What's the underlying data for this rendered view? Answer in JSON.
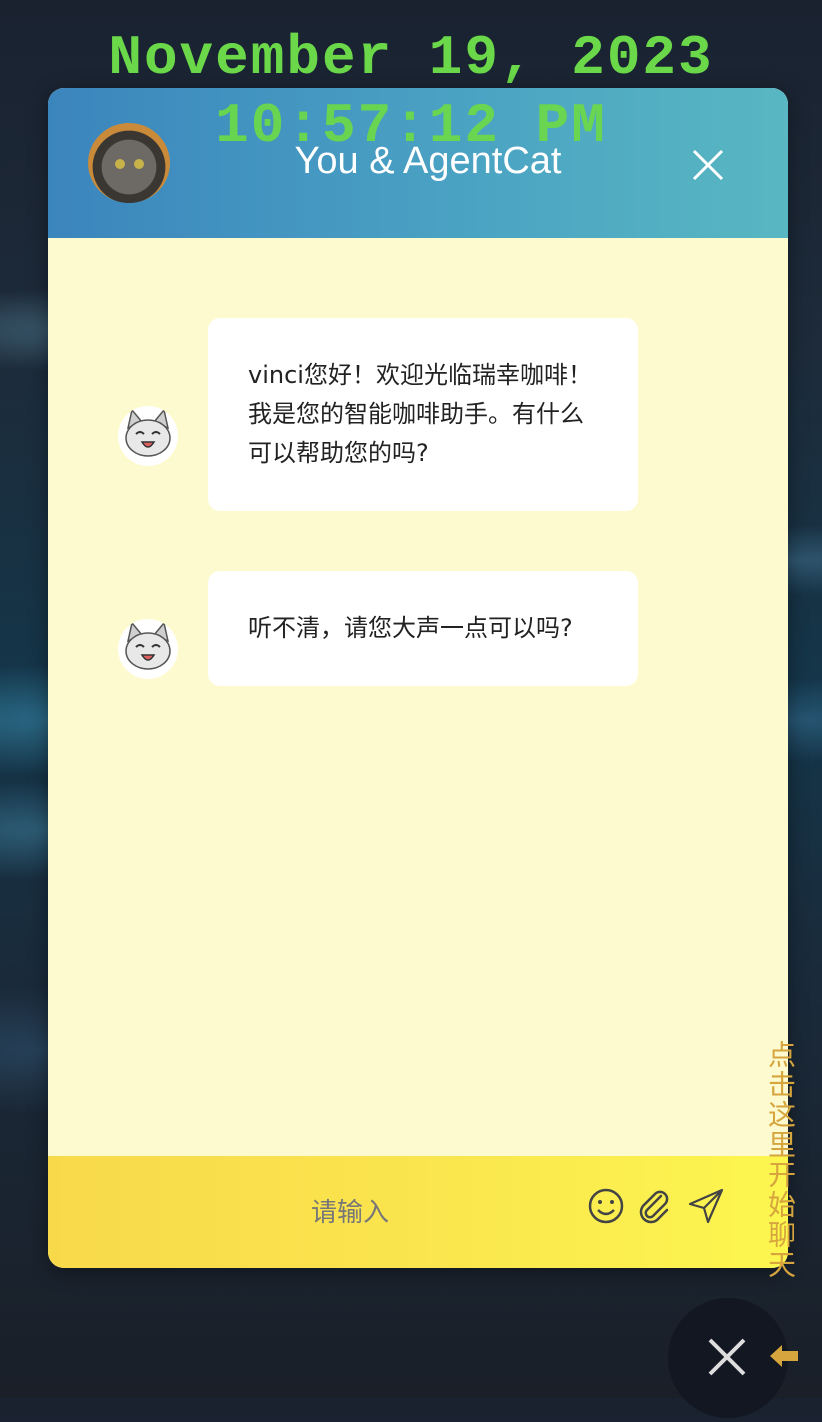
{
  "clock": {
    "date": "November 19, 2023",
    "time": "10:57:12 PM",
    "color": "#6bd84a"
  },
  "chat": {
    "title": "You & AgentCat",
    "header_avatar_icon": "cat-photo-avatar",
    "close_icon": "close-icon",
    "messages": [
      {
        "sender": "AgentCat",
        "avatar_icon": "cartoon-cat-icon",
        "text": "vinci您好！欢迎光临瑞幸咖啡！我是您的智能咖啡助手。有什么可以帮助您的吗?"
      },
      {
        "sender": "AgentCat",
        "avatar_icon": "cartoon-cat-icon",
        "text": "听不清，请您大声一点可以吗?"
      }
    ],
    "input": {
      "placeholder": "请输入",
      "value": ""
    },
    "toolbar_icons": [
      "smiley-icon",
      "paperclip-icon",
      "send-icon"
    ]
  },
  "side_hint": "点击这里开始聊天",
  "float_button_icon": "close-icon",
  "colors": {
    "header_start": "#3b85bd",
    "header_end": "#58b7c2",
    "chat_bg": "#fdfacf",
    "input_bar": "#fae54e",
    "hint": "#d6a53d"
  }
}
